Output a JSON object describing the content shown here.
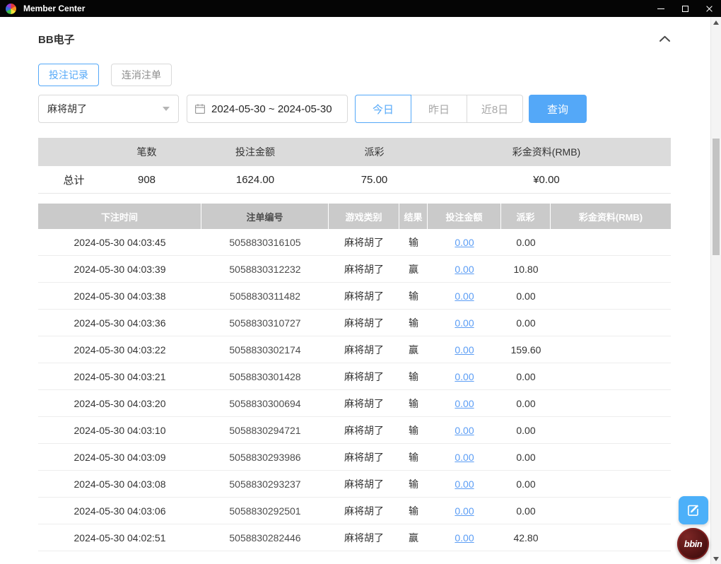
{
  "colors": {
    "titlebar_bg": "#050505",
    "accent_blue": "#54a8f8",
    "link_blue": "#5b9df5",
    "summary_header_bg": "#dbdbdb",
    "table_header_bg": "#cacaca",
    "table_header_text": "#ffffff",
    "brand_red": "#551414",
    "fab_blue": "#4cb0f9"
  },
  "window": {
    "title": "Member Center"
  },
  "panel": {
    "title": "BB电子"
  },
  "tabs": [
    {
      "label": "投注记录",
      "active": true
    },
    {
      "label": "连消注单",
      "active": false
    }
  ],
  "filters": {
    "game_type": "麻将胡了",
    "date_range": "2024-05-30 ~ 2024-05-30",
    "quick_ranges": [
      {
        "label": "今日",
        "active": true
      },
      {
        "label": "昨日",
        "active": false
      },
      {
        "label": "近8日",
        "active": false
      }
    ],
    "search_button": "查询"
  },
  "summary": {
    "headers": [
      "",
      "笔数",
      "投注金额",
      "派彩",
      "彩金资料(RMB)"
    ],
    "total_label": "总计",
    "count": "908",
    "bet_amount": "1624.00",
    "payout": "75.00",
    "bonus": "¥0.00"
  },
  "table": {
    "headers": [
      "下注时间",
      "注单编号",
      "游戏类别",
      "结果",
      "投注金额",
      "派彩",
      "彩金资料(RMB)"
    ],
    "rows": [
      {
        "time": "2024-05-30 04:03:45",
        "order_no": "5058830316105",
        "game": "麻将胡了",
        "result": "输",
        "bet": "0.00",
        "payout": "0.00",
        "bonus": ""
      },
      {
        "time": "2024-05-30 04:03:39",
        "order_no": "5058830312232",
        "game": "麻将胡了",
        "result": "赢",
        "bet": "0.00",
        "payout": "10.80",
        "bonus": ""
      },
      {
        "time": "2024-05-30 04:03:38",
        "order_no": "5058830311482",
        "game": "麻将胡了",
        "result": "输",
        "bet": "0.00",
        "payout": "0.00",
        "bonus": ""
      },
      {
        "time": "2024-05-30 04:03:36",
        "order_no": "5058830310727",
        "game": "麻将胡了",
        "result": "输",
        "bet": "0.00",
        "payout": "0.00",
        "bonus": ""
      },
      {
        "time": "2024-05-30 04:03:22",
        "order_no": "5058830302174",
        "game": "麻将胡了",
        "result": "赢",
        "bet": "0.00",
        "payout": "159.60",
        "bonus": ""
      },
      {
        "time": "2024-05-30 04:03:21",
        "order_no": "5058830301428",
        "game": "麻将胡了",
        "result": "输",
        "bet": "0.00",
        "payout": "0.00",
        "bonus": ""
      },
      {
        "time": "2024-05-30 04:03:20",
        "order_no": "5058830300694",
        "game": "麻将胡了",
        "result": "输",
        "bet": "0.00",
        "payout": "0.00",
        "bonus": ""
      },
      {
        "time": "2024-05-30 04:03:10",
        "order_no": "5058830294721",
        "game": "麻将胡了",
        "result": "输",
        "bet": "0.00",
        "payout": "0.00",
        "bonus": ""
      },
      {
        "time": "2024-05-30 04:03:09",
        "order_no": "5058830293986",
        "game": "麻将胡了",
        "result": "输",
        "bet": "0.00",
        "payout": "0.00",
        "bonus": ""
      },
      {
        "time": "2024-05-30 04:03:08",
        "order_no": "5058830293237",
        "game": "麻将胡了",
        "result": "输",
        "bet": "0.00",
        "payout": "0.00",
        "bonus": ""
      },
      {
        "time": "2024-05-30 04:03:06",
        "order_no": "5058830292501",
        "game": "麻将胡了",
        "result": "输",
        "bet": "0.00",
        "payout": "0.00",
        "bonus": ""
      },
      {
        "time": "2024-05-30 04:02:51",
        "order_no": "5058830282446",
        "game": "麻将胡了",
        "result": "赢",
        "bet": "0.00",
        "payout": "42.80",
        "bonus": ""
      }
    ]
  },
  "floating": {
    "brand_label": "bbin"
  }
}
